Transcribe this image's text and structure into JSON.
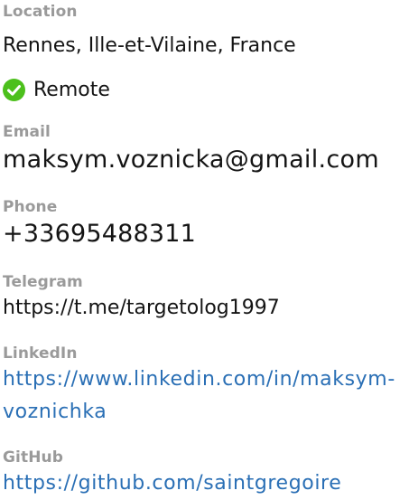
{
  "location": {
    "label": "Location",
    "value": "Rennes, Ille-et-Vilaine, France",
    "remote_label": "Remote",
    "remote_icon": "check-circle-icon",
    "remote_icon_color": "#4cc01c"
  },
  "email": {
    "label": "Email",
    "value": "maksym.voznicka@gmail.com"
  },
  "phone": {
    "label": "Phone",
    "value": "+33695488311"
  },
  "telegram": {
    "label": "Telegram",
    "value": "https://t.me/targetolog1997"
  },
  "linkedin": {
    "label": "LinkedIn",
    "value": "https://www.linkedin.com/in/maksym-voznichka"
  },
  "github": {
    "label": "GitHub",
    "value": "https://github.com/saintgregoire"
  },
  "colors": {
    "label": "#9a9a9a",
    "text": "#141414",
    "link": "#2a6fb5"
  }
}
